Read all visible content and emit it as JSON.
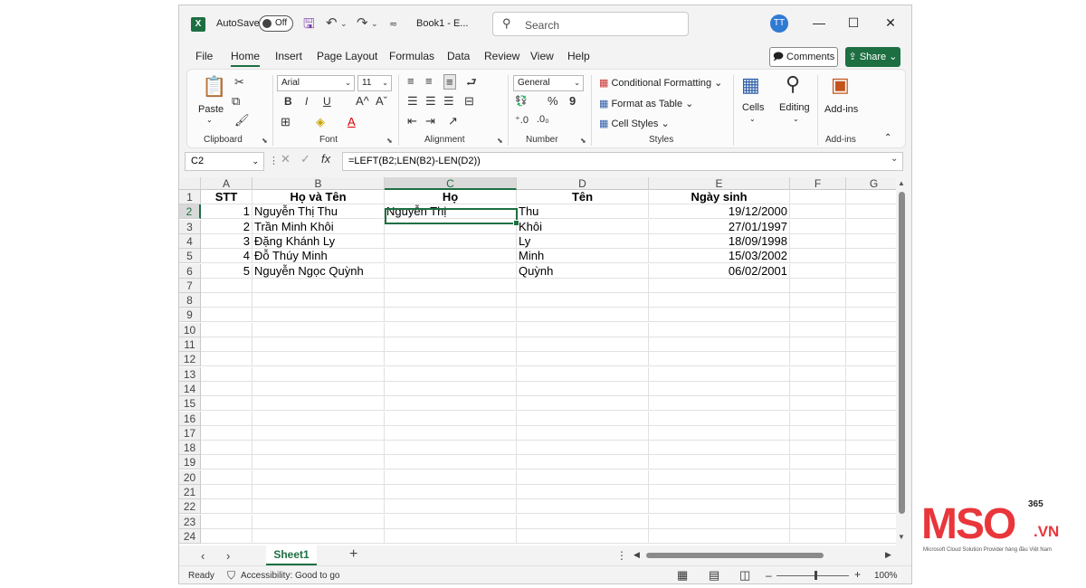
{
  "titlebar": {
    "autosave_label": "AutoSave",
    "autosave_state": "Off",
    "doc_title": "Book1 - E...",
    "search_placeholder": "Search",
    "avatar": "TT"
  },
  "menu": {
    "tabs": [
      "File",
      "Home",
      "Insert",
      "Page Layout",
      "Formulas",
      "Data",
      "Review",
      "View",
      "Help"
    ],
    "active": "Home",
    "comments": "Comments",
    "share": "Share"
  },
  "ribbon": {
    "clipboard": {
      "paste": "Paste",
      "label": "Clipboard"
    },
    "font": {
      "name": "Arial",
      "size": "11",
      "label": "Font"
    },
    "alignment": {
      "label": "Alignment"
    },
    "number": {
      "format": "General",
      "label": "Number"
    },
    "styles": {
      "conditional": "Conditional Formatting",
      "format_table": "Format as Table",
      "cell_styles": "Cell Styles",
      "label": "Styles"
    },
    "cells": {
      "label": "Cells"
    },
    "editing": {
      "label": "Editing"
    },
    "addins": {
      "button": "Add-ins",
      "label": "Add-ins"
    }
  },
  "formula_bar": {
    "name_box": "C2",
    "formula": "=LEFT(B2;LEN(B2)-LEN(D2))"
  },
  "grid": {
    "columns": [
      "A",
      "B",
      "C",
      "D",
      "E",
      "F",
      "G"
    ],
    "selected_column": "C",
    "selected_row": 2,
    "row_numbers": [
      "1",
      "2",
      "3",
      "4",
      "5",
      "6",
      "7",
      "8",
      "9",
      "10",
      "11",
      "12",
      "13",
      "14",
      "15",
      "16",
      "17",
      "18",
      "19",
      "20",
      "21",
      "22",
      "23",
      "24"
    ],
    "headers": [
      "STT",
      "Họ và Tên",
      "Họ",
      "Tên",
      "Ngày sinh"
    ],
    "rows": [
      [
        "1",
        "Nguyễn Thị Thu",
        "Nguyễn Thị",
        "Thu",
        "19/12/2000"
      ],
      [
        "2",
        "Trần Minh Khôi",
        "",
        "Khôi",
        "27/01/1997"
      ],
      [
        "3",
        "Đặng Khánh Ly",
        "",
        "Ly",
        "18/09/1998"
      ],
      [
        "4",
        "Đỗ Thúy Minh",
        "",
        "Minh",
        "15/03/2002"
      ],
      [
        "5",
        "Nguyễn Ngọc Quỳnh",
        "",
        "Quỳnh",
        "06/02/2001"
      ]
    ]
  },
  "sheets": {
    "tabs": [
      "Sheet1"
    ],
    "active": "Sheet1"
  },
  "status": {
    "ready": "Ready",
    "accessibility": "Accessibility: Good to go",
    "zoom": "100%"
  },
  "logo": {
    "brand": "MSO",
    "suffix": ".VN",
    "superscript": "365",
    "tagline": "Microsoft Cloud Solution Provider hàng đầu Việt Nam"
  },
  "colors": {
    "excel_green": "#1d6f42",
    "logo_red": "#e8363b",
    "avatar_blue": "#2f7ad3"
  }
}
